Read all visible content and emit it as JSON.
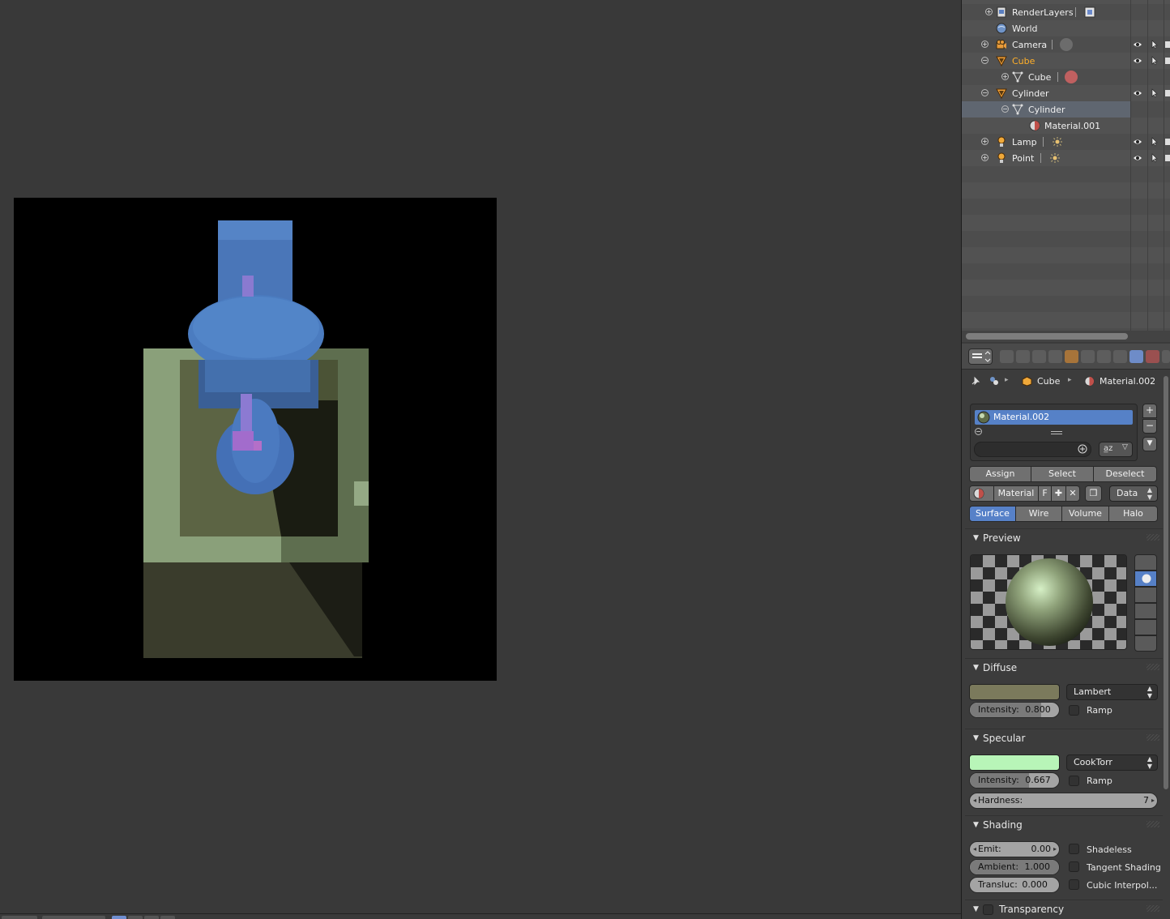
{
  "outliner": {
    "rows": [
      {
        "label": "RenderLayers"
      },
      {
        "label": "World"
      },
      {
        "label": "Camera"
      },
      {
        "label": "Cube"
      },
      {
        "label": "Cube"
      },
      {
        "label": "Cylinder"
      },
      {
        "label": "Cylinder"
      },
      {
        "label": "Material.001"
      },
      {
        "label": "Lamp"
      },
      {
        "label": "Point"
      }
    ]
  },
  "properties": {
    "breadcrumb": {
      "object": "Cube",
      "material": "Material.002"
    },
    "slot": {
      "name": "Material.002"
    },
    "actions": {
      "assign": "Assign",
      "select": "Select",
      "deselect": "Deselect"
    },
    "datablock": {
      "name": "Material",
      "fake": "F",
      "link": "Data"
    },
    "tabs": {
      "surface": "Surface",
      "wire": "Wire",
      "volume": "Volume",
      "halo": "Halo"
    },
    "preview": {
      "title": "Preview"
    },
    "diffuse": {
      "title": "Diffuse",
      "color": "#7b7a5c",
      "shader": "Lambert",
      "intensity_label": "Intensity:",
      "intensity": "0.800",
      "intensity_fraction": 0.8,
      "ramp": "Ramp"
    },
    "specular": {
      "title": "Specular",
      "color": "#b8f5b8",
      "shader": "CookTorr",
      "intensity_label": "Intensity:",
      "intensity": "0.667",
      "intensity_fraction": 0.667,
      "ramp": "Ramp",
      "hardness_label": "Hardness:",
      "hardness": "7"
    },
    "shading": {
      "title": "Shading",
      "emit_label": "Emit:",
      "emit": "0.00",
      "ambient_label": "Ambient:",
      "ambient": "1.000",
      "transluc_label": "Transluc:",
      "transluc": "0.000",
      "shadeless": "Shadeless",
      "tangent": "Tangent Shading",
      "cubic": "Cubic Interpol..."
    },
    "transparency": {
      "title": "Transparency"
    }
  },
  "colors": {
    "accent": "#5781c8",
    "object_orange": "#ffaf29"
  }
}
